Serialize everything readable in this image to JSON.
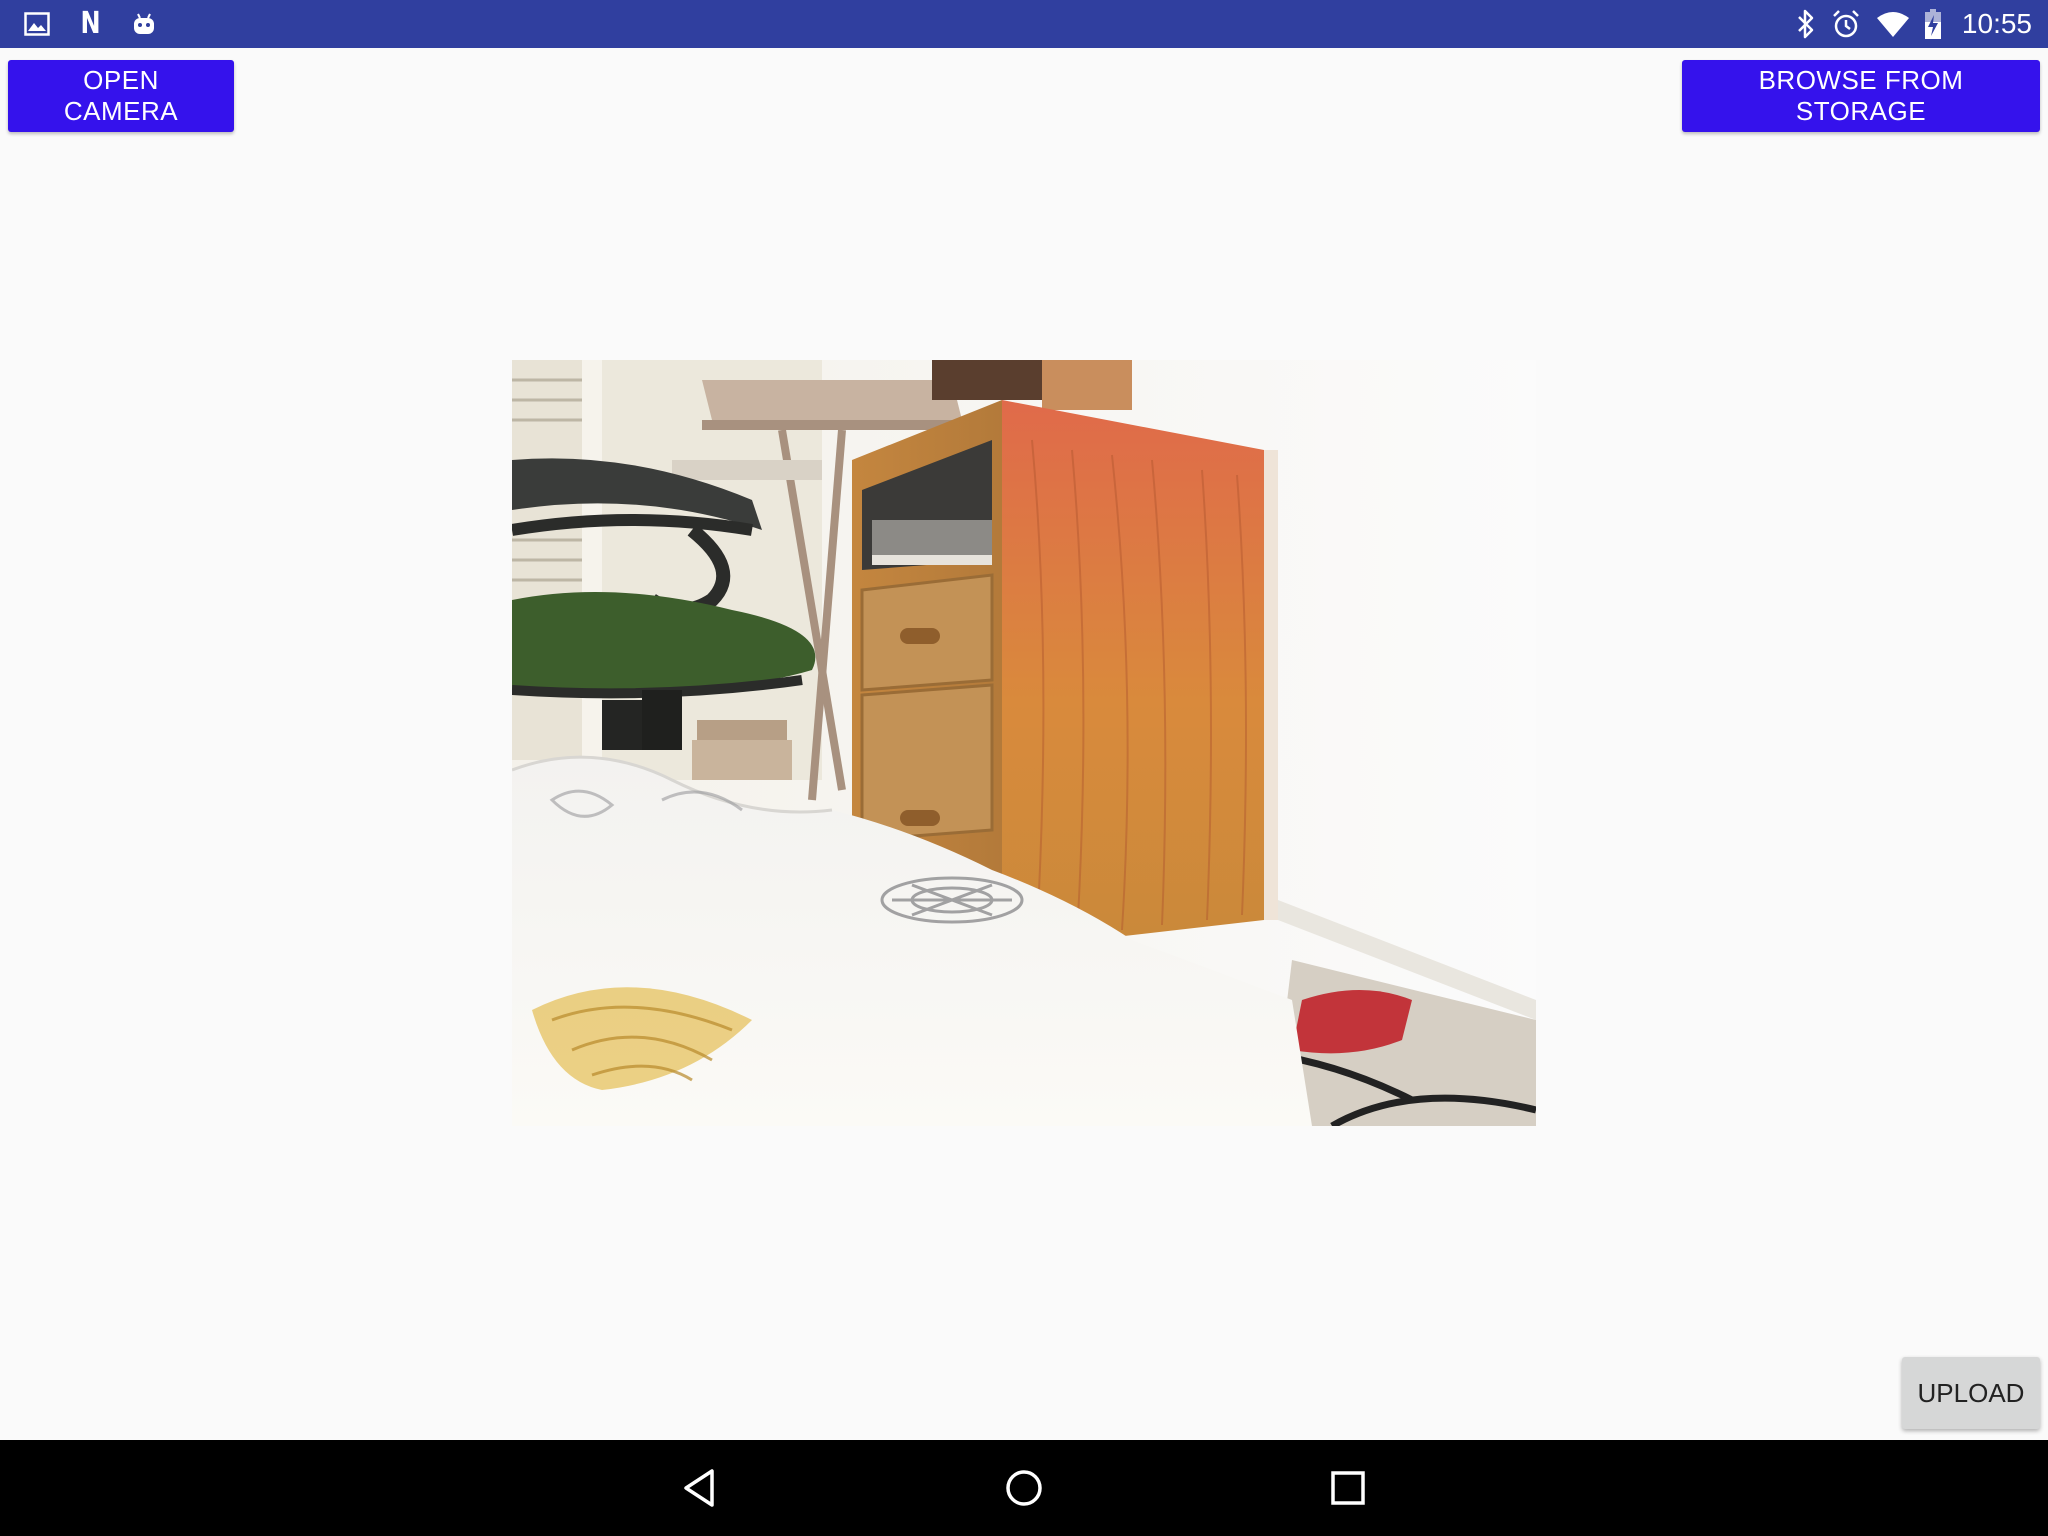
{
  "status_bar": {
    "left_icons": [
      "gallery-icon",
      "n-app-icon",
      "android-debug-icon"
    ],
    "n_letter": "N",
    "right_icons": [
      "bluetooth-icon",
      "alarm-icon",
      "wifi-icon",
      "battery-charging-icon"
    ],
    "time": "10:55",
    "background_color": "#303f9f"
  },
  "toolbar": {
    "open_camera_label": "OPEN CAMERA",
    "browse_label": "BROWSE FROM STORAGE",
    "accent_color": "#3512ec"
  },
  "preview": {
    "description_icon": "captured-photo"
  },
  "actions": {
    "upload_label": "UPLOAD"
  },
  "nav_bar": {
    "items": [
      "back-icon",
      "home-icon",
      "recents-icon"
    ]
  }
}
